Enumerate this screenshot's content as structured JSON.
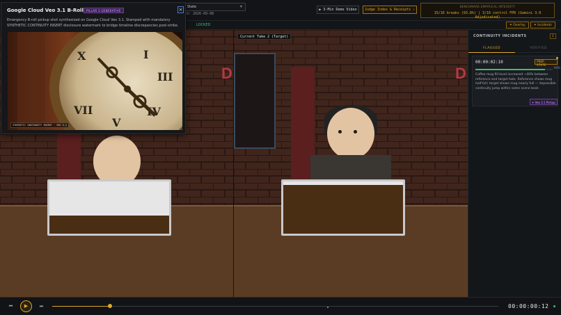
{
  "topbar": {
    "state_select": "p State",
    "date_line": "D: 2026-09-08",
    "demo_button": "▶ 3-Min Demo Video",
    "judge_button": "Judge Index & Receipts ›",
    "benchmark_title": "BENCHMARK EMPIRICAL INTEGRITY",
    "benchmark_value": "15/16 breaks (93.8%)  |  3/16 control FPR (Gemini 3.0 Adjudicated)"
  },
  "subbar": {
    "locked_label": "LOCKED",
    "overlay_button": "✦ Overlay",
    "incidents_button": "✦ Incidents"
  },
  "video": {
    "take_label": "Current Take 2 (Target)",
    "reference_mug_fill": 0.35,
    "target_mug_fill": 0.93
  },
  "popup": {
    "title": "Google Cloud Veo 3.1 B-Roll Pickup",
    "badge": "PILLAR 3 GENERATIVE",
    "close_label": "×",
    "description": "Emergency B-roll pickup shot synthesized on Google Cloud Veo 3.1. Stamped with mandatory SYNTHETIC CONTINUITY INSERT disclosure watermark to bridge timeline discrepancies post-strike.",
    "watermark": "SYNTHETIC CONTINUITY INSERT · VEO 3.1"
  },
  "panel": {
    "title": "CONTINUITY INCIDENTS",
    "count": "1",
    "tab_flagged": "FLAGGED",
    "tab_verified": "VERIFIED",
    "incident": {
      "time": "00:00:02:10",
      "tag": "PROP STATE",
      "confidence_label": "90%",
      "confidence": 0.9,
      "text": "Coffee mug fill level increased ~40% between reference and target take. Reference shows mug half-full; target shows mug nearly full — impossible continuity jump within same scene beat.",
      "veo_button": "✦ Veo 3.1 Pickup"
    }
  },
  "transport": {
    "skip_back": "⏮",
    "play": "▶",
    "skip_forward": "⏭",
    "timecode": "00:00:00:12",
    "progress": 0.13
  },
  "colors": {
    "accent": "#e0a82a",
    "success": "#3fbf6f",
    "generative": "#cfa6ff"
  }
}
